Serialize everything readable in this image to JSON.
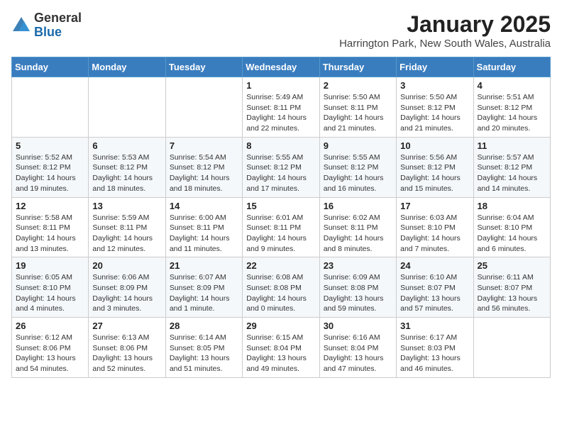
{
  "header": {
    "logo_general": "General",
    "logo_blue": "Blue",
    "month_year": "January 2025",
    "location": "Harrington Park, New South Wales, Australia"
  },
  "calendar": {
    "days_of_week": [
      "Sunday",
      "Monday",
      "Tuesday",
      "Wednesday",
      "Thursday",
      "Friday",
      "Saturday"
    ],
    "weeks": [
      [
        {
          "day": "",
          "info": ""
        },
        {
          "day": "",
          "info": ""
        },
        {
          "day": "",
          "info": ""
        },
        {
          "day": "1",
          "info": "Sunrise: 5:49 AM\nSunset: 8:11 PM\nDaylight: 14 hours\nand 22 minutes."
        },
        {
          "day": "2",
          "info": "Sunrise: 5:50 AM\nSunset: 8:11 PM\nDaylight: 14 hours\nand 21 minutes."
        },
        {
          "day": "3",
          "info": "Sunrise: 5:50 AM\nSunset: 8:12 PM\nDaylight: 14 hours\nand 21 minutes."
        },
        {
          "day": "4",
          "info": "Sunrise: 5:51 AM\nSunset: 8:12 PM\nDaylight: 14 hours\nand 20 minutes."
        }
      ],
      [
        {
          "day": "5",
          "info": "Sunrise: 5:52 AM\nSunset: 8:12 PM\nDaylight: 14 hours\nand 19 minutes."
        },
        {
          "day": "6",
          "info": "Sunrise: 5:53 AM\nSunset: 8:12 PM\nDaylight: 14 hours\nand 18 minutes."
        },
        {
          "day": "7",
          "info": "Sunrise: 5:54 AM\nSunset: 8:12 PM\nDaylight: 14 hours\nand 18 minutes."
        },
        {
          "day": "8",
          "info": "Sunrise: 5:55 AM\nSunset: 8:12 PM\nDaylight: 14 hours\nand 17 minutes."
        },
        {
          "day": "9",
          "info": "Sunrise: 5:55 AM\nSunset: 8:12 PM\nDaylight: 14 hours\nand 16 minutes."
        },
        {
          "day": "10",
          "info": "Sunrise: 5:56 AM\nSunset: 8:12 PM\nDaylight: 14 hours\nand 15 minutes."
        },
        {
          "day": "11",
          "info": "Sunrise: 5:57 AM\nSunset: 8:12 PM\nDaylight: 14 hours\nand 14 minutes."
        }
      ],
      [
        {
          "day": "12",
          "info": "Sunrise: 5:58 AM\nSunset: 8:11 PM\nDaylight: 14 hours\nand 13 minutes."
        },
        {
          "day": "13",
          "info": "Sunrise: 5:59 AM\nSunset: 8:11 PM\nDaylight: 14 hours\nand 12 minutes."
        },
        {
          "day": "14",
          "info": "Sunrise: 6:00 AM\nSunset: 8:11 PM\nDaylight: 14 hours\nand 11 minutes."
        },
        {
          "day": "15",
          "info": "Sunrise: 6:01 AM\nSunset: 8:11 PM\nDaylight: 14 hours\nand 9 minutes."
        },
        {
          "day": "16",
          "info": "Sunrise: 6:02 AM\nSunset: 8:11 PM\nDaylight: 14 hours\nand 8 minutes."
        },
        {
          "day": "17",
          "info": "Sunrise: 6:03 AM\nSunset: 8:10 PM\nDaylight: 14 hours\nand 7 minutes."
        },
        {
          "day": "18",
          "info": "Sunrise: 6:04 AM\nSunset: 8:10 PM\nDaylight: 14 hours\nand 6 minutes."
        }
      ],
      [
        {
          "day": "19",
          "info": "Sunrise: 6:05 AM\nSunset: 8:10 PM\nDaylight: 14 hours\nand 4 minutes."
        },
        {
          "day": "20",
          "info": "Sunrise: 6:06 AM\nSunset: 8:09 PM\nDaylight: 14 hours\nand 3 minutes."
        },
        {
          "day": "21",
          "info": "Sunrise: 6:07 AM\nSunset: 8:09 PM\nDaylight: 14 hours\nand 1 minute."
        },
        {
          "day": "22",
          "info": "Sunrise: 6:08 AM\nSunset: 8:08 PM\nDaylight: 14 hours\nand 0 minutes."
        },
        {
          "day": "23",
          "info": "Sunrise: 6:09 AM\nSunset: 8:08 PM\nDaylight: 13 hours\nand 59 minutes."
        },
        {
          "day": "24",
          "info": "Sunrise: 6:10 AM\nSunset: 8:07 PM\nDaylight: 13 hours\nand 57 minutes."
        },
        {
          "day": "25",
          "info": "Sunrise: 6:11 AM\nSunset: 8:07 PM\nDaylight: 13 hours\nand 56 minutes."
        }
      ],
      [
        {
          "day": "26",
          "info": "Sunrise: 6:12 AM\nSunset: 8:06 PM\nDaylight: 13 hours\nand 54 minutes."
        },
        {
          "day": "27",
          "info": "Sunrise: 6:13 AM\nSunset: 8:06 PM\nDaylight: 13 hours\nand 52 minutes."
        },
        {
          "day": "28",
          "info": "Sunrise: 6:14 AM\nSunset: 8:05 PM\nDaylight: 13 hours\nand 51 minutes."
        },
        {
          "day": "29",
          "info": "Sunrise: 6:15 AM\nSunset: 8:04 PM\nDaylight: 13 hours\nand 49 minutes."
        },
        {
          "day": "30",
          "info": "Sunrise: 6:16 AM\nSunset: 8:04 PM\nDaylight: 13 hours\nand 47 minutes."
        },
        {
          "day": "31",
          "info": "Sunrise: 6:17 AM\nSunset: 8:03 PM\nDaylight: 13 hours\nand 46 minutes."
        },
        {
          "day": "",
          "info": ""
        }
      ]
    ]
  }
}
